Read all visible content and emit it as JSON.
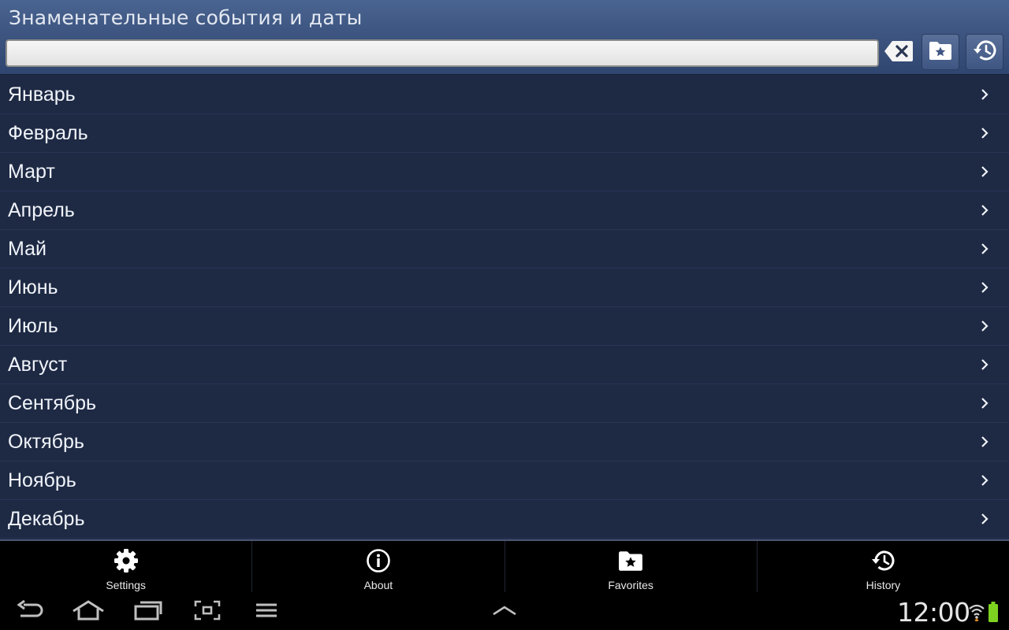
{
  "app": {
    "title": "Знаменательные события и даты"
  },
  "search": {
    "value": "",
    "placeholder": ""
  },
  "months": [
    {
      "label": "Январь"
    },
    {
      "label": "Февраль"
    },
    {
      "label": "Март"
    },
    {
      "label": "Апрель"
    },
    {
      "label": "Май"
    },
    {
      "label": "Июнь"
    },
    {
      "label": "Июль"
    },
    {
      "label": "Август"
    },
    {
      "label": "Сентябрь"
    },
    {
      "label": "Октябрь"
    },
    {
      "label": "Ноябрь"
    },
    {
      "label": "Декабрь"
    }
  ],
  "toolbar": {
    "settings_label": "Settings",
    "about_label": "About",
    "favorites_label": "Favorites",
    "history_label": "History"
  },
  "status_bar": {
    "time": "12:00"
  },
  "icons": {
    "clear": "backspace-clear-icon",
    "favorites": "star-folder-icon",
    "history": "history-clock-icon",
    "settings": "gear-icon",
    "about": "info-icon",
    "chevron": "chevron-right-icon"
  },
  "colors": {
    "header": "#3d5580",
    "list_background": "#1e2a44",
    "toolbar_background": "#000000",
    "battery": "#7ed321"
  }
}
